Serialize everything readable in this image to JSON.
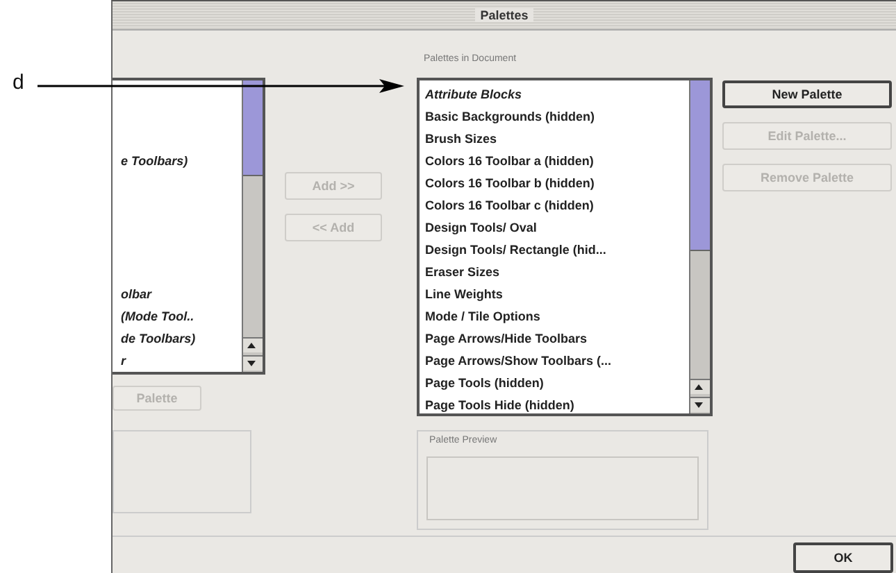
{
  "annotation": {
    "label": "d"
  },
  "window": {
    "title": "Palettes"
  },
  "left_list": {
    "items": [
      {
        "text": "e Toolbars)"
      },
      {
        "text": "olbar"
      },
      {
        "text": "(Mode Tool.."
      },
      {
        "text": "de Toolbars)"
      },
      {
        "text": "r"
      }
    ]
  },
  "left_palette_button": {
    "label": "Palette",
    "disabled": true
  },
  "add_buttons": [
    {
      "label": "Add >>",
      "disabled": true
    },
    {
      "label": "<< Add",
      "disabled": true
    }
  ],
  "palettes_in_document": {
    "label": "Palettes in Document",
    "items": [
      {
        "text": "Attribute Blocks",
        "kind": "italic"
      },
      {
        "text": "Basic Backgrounds (hidden)",
        "kind": "bold"
      },
      {
        "text": "Brush Sizes",
        "kind": "bold"
      },
      {
        "text": "Colors 16 Toolbar a (hidden)",
        "kind": "bold"
      },
      {
        "text": "Colors 16 Toolbar b (hidden)",
        "kind": "bold"
      },
      {
        "text": "Colors 16 Toolbar c (hidden)",
        "kind": "bold"
      },
      {
        "text": "Design Tools/ Oval",
        "kind": "bold"
      },
      {
        "text": "Design Tools/ Rectangle (hid...",
        "kind": "bold"
      },
      {
        "text": "Eraser Sizes",
        "kind": "bold"
      },
      {
        "text": "Line Weights",
        "kind": "bold"
      },
      {
        "text": "Mode / Tile Options",
        "kind": "bold"
      },
      {
        "text": "Page Arrows/Hide Toolbars",
        "kind": "bold"
      },
      {
        "text": "Page Arrows/Show Toolbars (...",
        "kind": "bold"
      },
      {
        "text": "Page Tools (hidden)",
        "kind": "bold"
      },
      {
        "text": "Page Tools Hide (hidden)",
        "kind": "bold"
      }
    ]
  },
  "side_buttons": [
    {
      "label": "New Palette",
      "disabled": false,
      "default": true
    },
    {
      "label": "Edit Palette...",
      "disabled": true,
      "default": false
    },
    {
      "label": "Remove Palette",
      "disabled": true,
      "default": false
    }
  ],
  "palette_preview": {
    "label": "Palette Preview"
  },
  "ok_button": {
    "label": "OK",
    "default": true
  }
}
